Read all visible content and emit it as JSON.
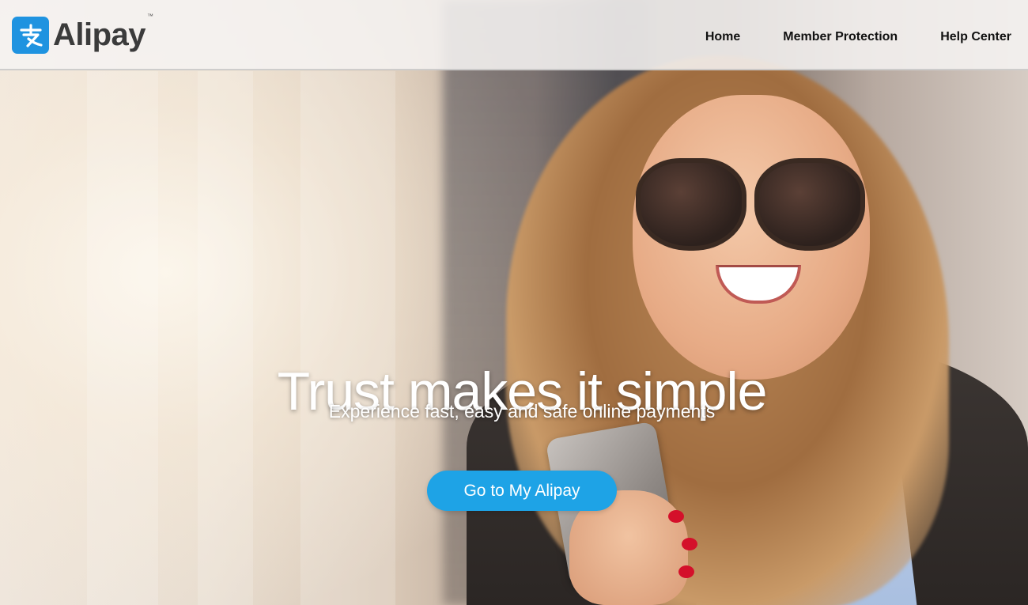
{
  "header": {
    "logo_text": "Alipay",
    "logo_tm": "™",
    "logo_glyph": "支",
    "nav": [
      {
        "label": "Home"
      },
      {
        "label": "Member Protection"
      },
      {
        "label": "Help Center"
      }
    ]
  },
  "hero": {
    "title": "Trust makes it simple",
    "subtitle": "Experience fast, easy and safe online payments",
    "cta_label": "Go to My Alipay"
  },
  "colors": {
    "brand_blue": "#1f93e0",
    "cta_blue": "#1ea3e6",
    "nav_text": "#111111"
  },
  "icons": {
    "logo": "alipay-logo-icon"
  }
}
